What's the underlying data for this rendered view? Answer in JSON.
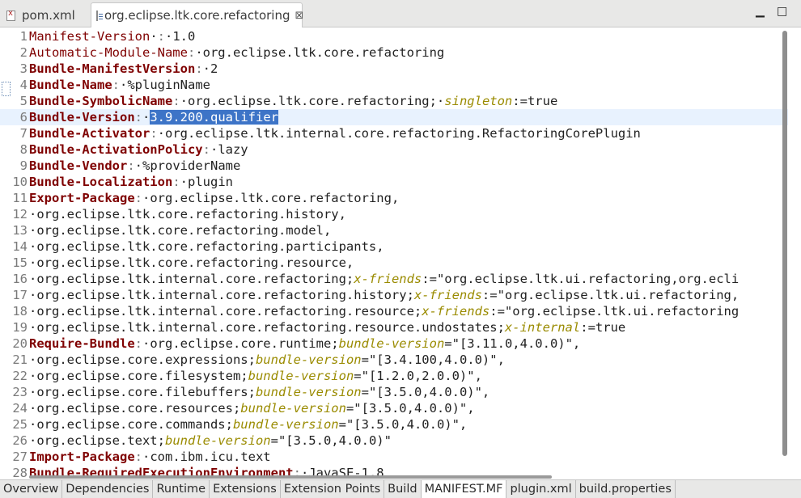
{
  "editor_tabs": [
    {
      "label": "pom.xml",
      "icon": "xml-file-icon",
      "active": false
    },
    {
      "label": "org.eclipse.ltk.core.refactoring",
      "icon": "manifest-file-icon",
      "active": true
    }
  ],
  "window_controls": {
    "minimize": "▁",
    "maximize": "□"
  },
  "close_glyph": "⊠",
  "selected_text": "3.9.200.qualifier",
  "current_line": 6,
  "lines": [
    {
      "n": "1",
      "segs": [
        [
          "k",
          "Manifest-Version"
        ],
        [
          "",
          "·"
        ],
        [
          "d",
          ":"
        ],
        [
          "",
          "·1.0"
        ]
      ]
    },
    {
      "n": "2",
      "segs": [
        [
          "k",
          "Automatic-Module-Name"
        ],
        [
          "d",
          ":"
        ],
        [
          "",
          "·org.eclipse.ltk.core.refactoring"
        ]
      ]
    },
    {
      "n": "3",
      "segs": [
        [
          "kb",
          "Bundle-ManifestVersion"
        ],
        [
          "d",
          ":"
        ],
        [
          "",
          "·2"
        ]
      ]
    },
    {
      "n": "4",
      "segs": [
        [
          "kb",
          "Bundle-Name"
        ],
        [
          "d",
          ":"
        ],
        [
          "",
          "·%pluginName"
        ]
      ]
    },
    {
      "n": "5",
      "segs": [
        [
          "kb",
          "Bundle-SymbolicName"
        ],
        [
          "d",
          ":"
        ],
        [
          "",
          "·org.eclipse.ltk.core.refactoring;·"
        ],
        [
          "a",
          "singleton"
        ],
        [
          "",
          ":=true"
        ]
      ]
    },
    {
      "n": "6",
      "segs": [
        [
          "kb",
          "Bundle-Version"
        ],
        [
          "d",
          ":"
        ],
        [
          "",
          "·"
        ],
        [
          "sel",
          "3.9.200.qualifier"
        ]
      ]
    },
    {
      "n": "7",
      "segs": [
        [
          "kb",
          "Bundle-Activator"
        ],
        [
          "d",
          ":"
        ],
        [
          "",
          "·org.eclipse.ltk.internal.core.refactoring.RefactoringCorePlugin"
        ]
      ]
    },
    {
      "n": "8",
      "segs": [
        [
          "kb",
          "Bundle-ActivationPolicy"
        ],
        [
          "d",
          ":"
        ],
        [
          "",
          "·lazy"
        ]
      ]
    },
    {
      "n": "9",
      "segs": [
        [
          "kb",
          "Bundle-Vendor"
        ],
        [
          "d",
          ":"
        ],
        [
          "",
          "·%providerName"
        ]
      ]
    },
    {
      "n": "10",
      "segs": [
        [
          "kb",
          "Bundle-Localization"
        ],
        [
          "d",
          ":"
        ],
        [
          "",
          "·plugin"
        ]
      ]
    },
    {
      "n": "11",
      "segs": [
        [
          "kb",
          "Export-Package"
        ],
        [
          "d",
          ":"
        ],
        [
          "",
          "·org.eclipse.ltk.core.refactoring,"
        ]
      ]
    },
    {
      "n": "12",
      "segs": [
        [
          "",
          "·org.eclipse.ltk.core.refactoring.history,"
        ]
      ]
    },
    {
      "n": "13",
      "segs": [
        [
          "",
          "·org.eclipse.ltk.core.refactoring.model,"
        ]
      ]
    },
    {
      "n": "14",
      "segs": [
        [
          "",
          "·org.eclipse.ltk.core.refactoring.participants,"
        ]
      ]
    },
    {
      "n": "15",
      "segs": [
        [
          "",
          "·org.eclipse.ltk.core.refactoring.resource,"
        ]
      ]
    },
    {
      "n": "16",
      "segs": [
        [
          "",
          "·org.eclipse.ltk.internal.core.refactoring;"
        ],
        [
          "a",
          "x-friends"
        ],
        [
          "",
          ":=\"org.eclipse.ltk.ui.refactoring,org.ecli"
        ]
      ]
    },
    {
      "n": "17",
      "segs": [
        [
          "",
          "·org.eclipse.ltk.internal.core.refactoring.history;"
        ],
        [
          "a",
          "x-friends"
        ],
        [
          "",
          ":=\"org.eclipse.ltk.ui.refactoring,"
        ]
      ]
    },
    {
      "n": "18",
      "segs": [
        [
          "",
          "·org.eclipse.ltk.internal.core.refactoring.resource;"
        ],
        [
          "a",
          "x-friends"
        ],
        [
          "",
          ":=\"org.eclipse.ltk.ui.refactoring"
        ]
      ]
    },
    {
      "n": "19",
      "segs": [
        [
          "",
          "·org.eclipse.ltk.internal.core.refactoring.resource.undostates;"
        ],
        [
          "a",
          "x-internal"
        ],
        [
          "",
          ":=true"
        ]
      ]
    },
    {
      "n": "20",
      "segs": [
        [
          "kb",
          "Require-Bundle"
        ],
        [
          "d",
          ":"
        ],
        [
          "",
          "·org.eclipse.core.runtime;"
        ],
        [
          "a",
          "bundle-version"
        ],
        [
          "",
          "=\"[3.11.0,4.0.0)\","
        ]
      ]
    },
    {
      "n": "21",
      "segs": [
        [
          "",
          "·org.eclipse.core.expressions;"
        ],
        [
          "a",
          "bundle-version"
        ],
        [
          "",
          "=\"[3.4.100,4.0.0)\","
        ]
      ]
    },
    {
      "n": "22",
      "segs": [
        [
          "",
          "·org.eclipse.core.filesystem;"
        ],
        [
          "a",
          "bundle-version"
        ],
        [
          "",
          "=\"[1.2.0,2.0.0)\","
        ]
      ]
    },
    {
      "n": "23",
      "segs": [
        [
          "",
          "·org.eclipse.core.filebuffers;"
        ],
        [
          "a",
          "bundle-version"
        ],
        [
          "",
          "=\"[3.5.0,4.0.0)\","
        ]
      ]
    },
    {
      "n": "24",
      "segs": [
        [
          "",
          "·org.eclipse.core.resources;"
        ],
        [
          "a",
          "bundle-version"
        ],
        [
          "",
          "=\"[3.5.0,4.0.0)\","
        ]
      ]
    },
    {
      "n": "25",
      "segs": [
        [
          "",
          "·org.eclipse.core.commands;"
        ],
        [
          "a",
          "bundle-version"
        ],
        [
          "",
          "=\"[3.5.0,4.0.0)\","
        ]
      ]
    },
    {
      "n": "26",
      "segs": [
        [
          "",
          "·org.eclipse.text;"
        ],
        [
          "a",
          "bundle-version"
        ],
        [
          "",
          "=\"[3.5.0,4.0.0)\""
        ]
      ]
    },
    {
      "n": "27",
      "segs": [
        [
          "kb",
          "Import-Package"
        ],
        [
          "d",
          ":"
        ],
        [
          "",
          "·com.ibm.icu.text"
        ]
      ]
    },
    {
      "n": "28",
      "segs": [
        [
          "kb",
          "Bundle-RequiredExecutionEnvironment"
        ],
        [
          "d",
          ":"
        ],
        [
          "",
          "·JavaSE-1.8"
        ]
      ]
    }
  ],
  "bottom_tabs": [
    "Overview",
    "Dependencies",
    "Runtime",
    "Extensions",
    "Extension Points",
    "Build",
    "MANIFEST.MF",
    "plugin.xml",
    "build.properties"
  ],
  "active_bottom_tab": "MANIFEST.MF",
  "colors": {
    "keyword": "#7f0000",
    "attribute": "#9a8b00",
    "selection": "#3d74c7",
    "current_line": "#e8f2fe"
  }
}
